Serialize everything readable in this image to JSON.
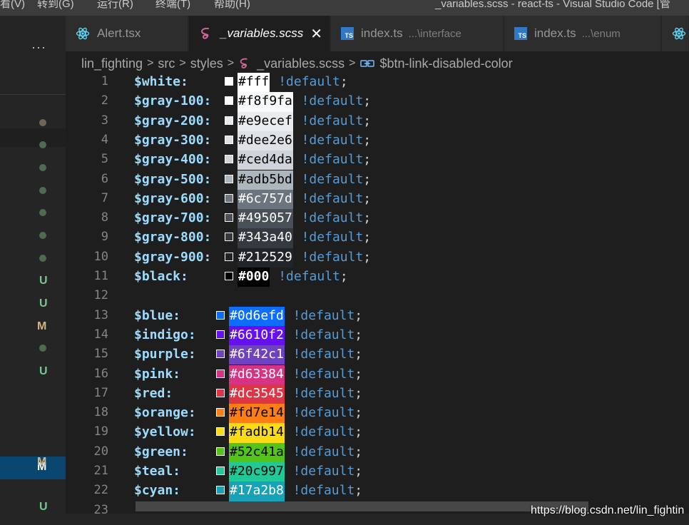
{
  "titlebar": {
    "menu": [
      "看(V)",
      "转到(G)",
      "运行(R)",
      "终端(T)",
      "帮助(H)"
    ],
    "title": "_variables.scss - react-ts - Visual Studio Code [管"
  },
  "sidebar": {
    "more_label": "···",
    "markers": [
      "•",
      "•",
      "•",
      "•",
      "•",
      "•",
      "•",
      "U",
      "U",
      "M",
      "•",
      "U",
      "M",
      "M",
      "U"
    ]
  },
  "tabs": [
    {
      "label": "Alert.tsx",
      "icon": "react-icon",
      "desc": "",
      "active": false
    },
    {
      "label": "_variables.scss",
      "icon": "sass-icon",
      "desc": "",
      "active": true
    },
    {
      "label": "index.ts",
      "icon": "typescript-icon",
      "desc": "...\\interface",
      "active": false
    },
    {
      "label": "index.ts",
      "icon": "typescript-icon",
      "desc": "...\\enum",
      "active": false
    }
  ],
  "ts_badge": "TS",
  "breadcrumb": {
    "items": [
      "lin_fighting",
      "src",
      "styles",
      "_variables.scss",
      "$btn-link-disabled-color"
    ]
  },
  "editor": {
    "keyword": "!default",
    "lines": [
      {
        "n": "1",
        "var": "$white:",
        "hex": "#fff",
        "color": "#ffffff"
      },
      {
        "n": "2",
        "var": "$gray-100:",
        "hex": "#f8f9fa",
        "color": "#f8f9fa"
      },
      {
        "n": "3",
        "var": "$gray-200:",
        "hex": "#e9ecef",
        "color": "#e9ecef"
      },
      {
        "n": "4",
        "var": "$gray-300:",
        "hex": "#dee2e6",
        "color": "#dee2e6"
      },
      {
        "n": "5",
        "var": "$gray-400:",
        "hex": "#ced4da",
        "color": "#ced4da"
      },
      {
        "n": "6",
        "var": "$gray-500:",
        "hex": "#adb5bd",
        "color": "#adb5bd"
      },
      {
        "n": "7",
        "var": "$gray-600:",
        "hex": "#6c757d",
        "color": "#6c757d"
      },
      {
        "n": "8",
        "var": "$gray-700:",
        "hex": "#495057",
        "color": "#495057"
      },
      {
        "n": "9",
        "var": "$gray-800:",
        "hex": "#343a40",
        "color": "#343a40"
      },
      {
        "n": "10",
        "var": "$gray-900:",
        "hex": "#212529",
        "color": "#212529"
      },
      {
        "n": "11",
        "var": "$black:",
        "hex": "#000",
        "color": "#000000"
      },
      {
        "n": "12",
        "var": "",
        "hex": "",
        "color": ""
      },
      {
        "n": "13",
        "var": "$blue:",
        "hex": "#0d6efd",
        "color": "#0d6efd"
      },
      {
        "n": "14",
        "var": "$indigo:",
        "hex": "#6610f2",
        "color": "#6610f2"
      },
      {
        "n": "15",
        "var": "$purple:",
        "hex": "#6f42c1",
        "color": "#6f42c1"
      },
      {
        "n": "16",
        "var": "$pink:",
        "hex": "#d63384",
        "color": "#d63384"
      },
      {
        "n": "17",
        "var": "$red:",
        "hex": "#dc3545",
        "color": "#dc3545"
      },
      {
        "n": "18",
        "var": "$orange:",
        "hex": "#fd7e14",
        "color": "#fd7e14"
      },
      {
        "n": "19",
        "var": "$yellow:",
        "hex": "#fadb14",
        "color": "#fadb14"
      },
      {
        "n": "20",
        "var": "$green:",
        "hex": "#52c41a",
        "color": "#52c41a"
      },
      {
        "n": "21",
        "var": "$teal:",
        "hex": "#20c997",
        "color": "#20c997"
      },
      {
        "n": "22",
        "var": "$cyan:",
        "hex": "#17a2b8",
        "color": "#17a2b8"
      },
      {
        "n": "23",
        "var": "",
        "hex": "",
        "color": ""
      }
    ]
  },
  "watermark": "https://blog.csdn.net/lin_fightin"
}
